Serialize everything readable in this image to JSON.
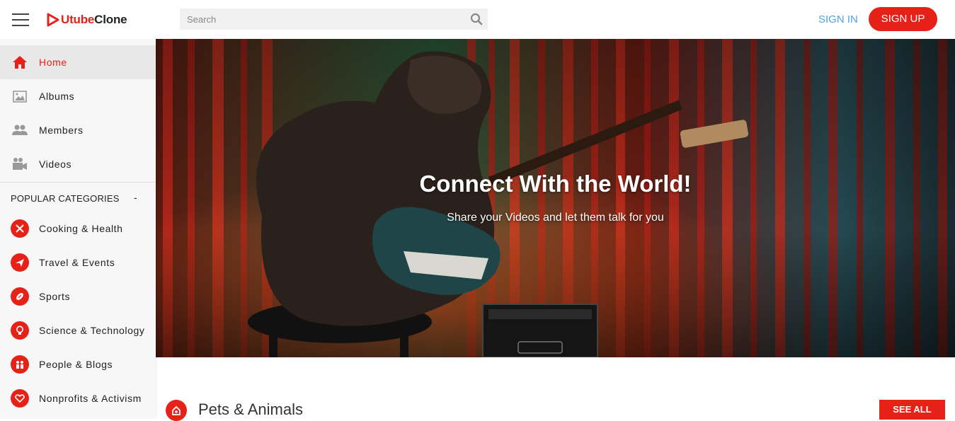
{
  "header": {
    "logo_prefix": "Utube",
    "logo_suffix": "Clone",
    "search_placeholder": "Search",
    "signin_label": "SIGN IN",
    "signup_label": "SIGN UP"
  },
  "sidebar": {
    "nav": [
      {
        "label": "Home",
        "icon": "home-icon",
        "active": true
      },
      {
        "label": "Albums",
        "icon": "image-icon"
      },
      {
        "label": "Members",
        "icon": "people-icon"
      },
      {
        "label": "Videos",
        "icon": "video-camera-icon"
      }
    ],
    "categories_heading": "POPULAR CATEGORIES",
    "categories_toggle": "-",
    "categories": [
      {
        "label": "Cooking & Health",
        "icon": "utensils-icon"
      },
      {
        "label": "Travel & Events",
        "icon": "plane-icon"
      },
      {
        "label": "Sports",
        "icon": "football-icon"
      },
      {
        "label": "Science & Technology",
        "icon": "lightbulb-icon"
      },
      {
        "label": "People & Blogs",
        "icon": "people-icon"
      },
      {
        "label": "Nonprofits & Activism",
        "icon": "heart-icon"
      }
    ]
  },
  "hero": {
    "title": "Connect With the World!",
    "subtitle": "Share your Videos and let them talk for you"
  },
  "section": {
    "title": "Pets & Animals",
    "icon": "pet-icon",
    "see_all_label": "SEE ALL"
  },
  "colors": {
    "brand_red": "#e62117",
    "signin_blue": "#4fa3e0"
  }
}
